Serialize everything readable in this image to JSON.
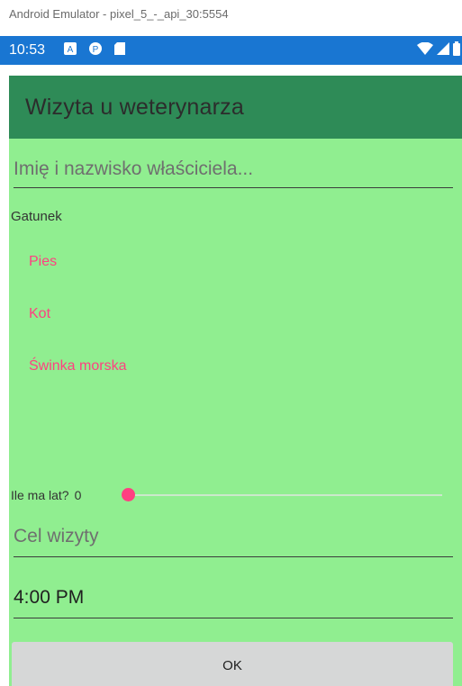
{
  "window_title": "Android Emulator - pixel_5_-_api_30:5554",
  "statusbar": {
    "time": "10:53",
    "left_icons": [
      "notification-a-icon",
      "p-icon",
      "sd-card-icon"
    ],
    "right_icons": [
      "wifi-icon",
      "signal-icon",
      "battery-icon"
    ],
    "background": "#1976d2"
  },
  "app": {
    "title": "Wizyta u weterynarza",
    "header_background": "#2e8b57",
    "background": "#90ee90",
    "owner_placeholder": "Imię i nazwisko właściciela...",
    "species_label": "Gatunek",
    "species": [
      "Pies",
      "Kot",
      "Świnka morska"
    ],
    "accent": "#ff4081",
    "age_label": "Ile ma lat?",
    "age_value": "0",
    "age_slider_fraction": 0,
    "purpose_placeholder": "Cel wizyty",
    "time_value": "4:00 PM",
    "ok_label": "OK"
  }
}
